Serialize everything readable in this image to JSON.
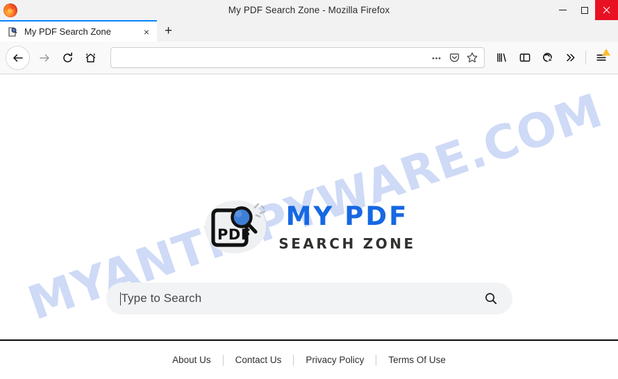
{
  "window": {
    "title": "My PDF Search Zone - Mozilla Firefox",
    "minimize_label": "Minimize",
    "maximize_label": "Maximize",
    "close_label": "Close",
    "app_icon": "firefox-logo"
  },
  "tabs": {
    "items": [
      {
        "label": "My PDF Search Zone",
        "favicon": "pdf-search-favicon",
        "close_label": "×",
        "active": true
      }
    ],
    "new_tab_label": "+"
  },
  "toolbar": {
    "back_icon": "back-arrow-icon",
    "forward_icon": "forward-arrow-icon",
    "reload_icon": "reload-icon",
    "home_icon": "home-icon",
    "url_value": "",
    "url_placeholder": "",
    "page_actions_icon": "ellipsis-icon",
    "pocket_icon": "pocket-icon",
    "bookmark_icon": "star-icon",
    "library_icon": "library-icon",
    "sidebar_icon": "sidebar-icon",
    "account_icon": "account-warning-icon",
    "overflow_icon": "chevrons-right-icon",
    "menu_icon": "hamburger-menu-icon",
    "menu_badge": "warning-triangle-badge"
  },
  "page": {
    "watermark": "MYANTISPYWARE.COM",
    "watermark_color": "#ccd9f6",
    "logo": {
      "icon_name": "pdf-magnifier-logo-icon",
      "icon_text": "PDF",
      "word_primary": "MY",
      "word_secondary": "PDF",
      "word_primary_color": "#1668e3",
      "tagline_first": "SEARCH",
      "tagline_second": "ZONE",
      "tagline_color": "#30302f"
    },
    "search": {
      "placeholder": "Type to Search",
      "value": "",
      "submit_icon": "search-icon"
    },
    "footer": {
      "links": [
        {
          "label": "About Us"
        },
        {
          "label": "Contact Us"
        },
        {
          "label": "Privacy Policy"
        },
        {
          "label": "Terms Of Use"
        }
      ]
    }
  }
}
